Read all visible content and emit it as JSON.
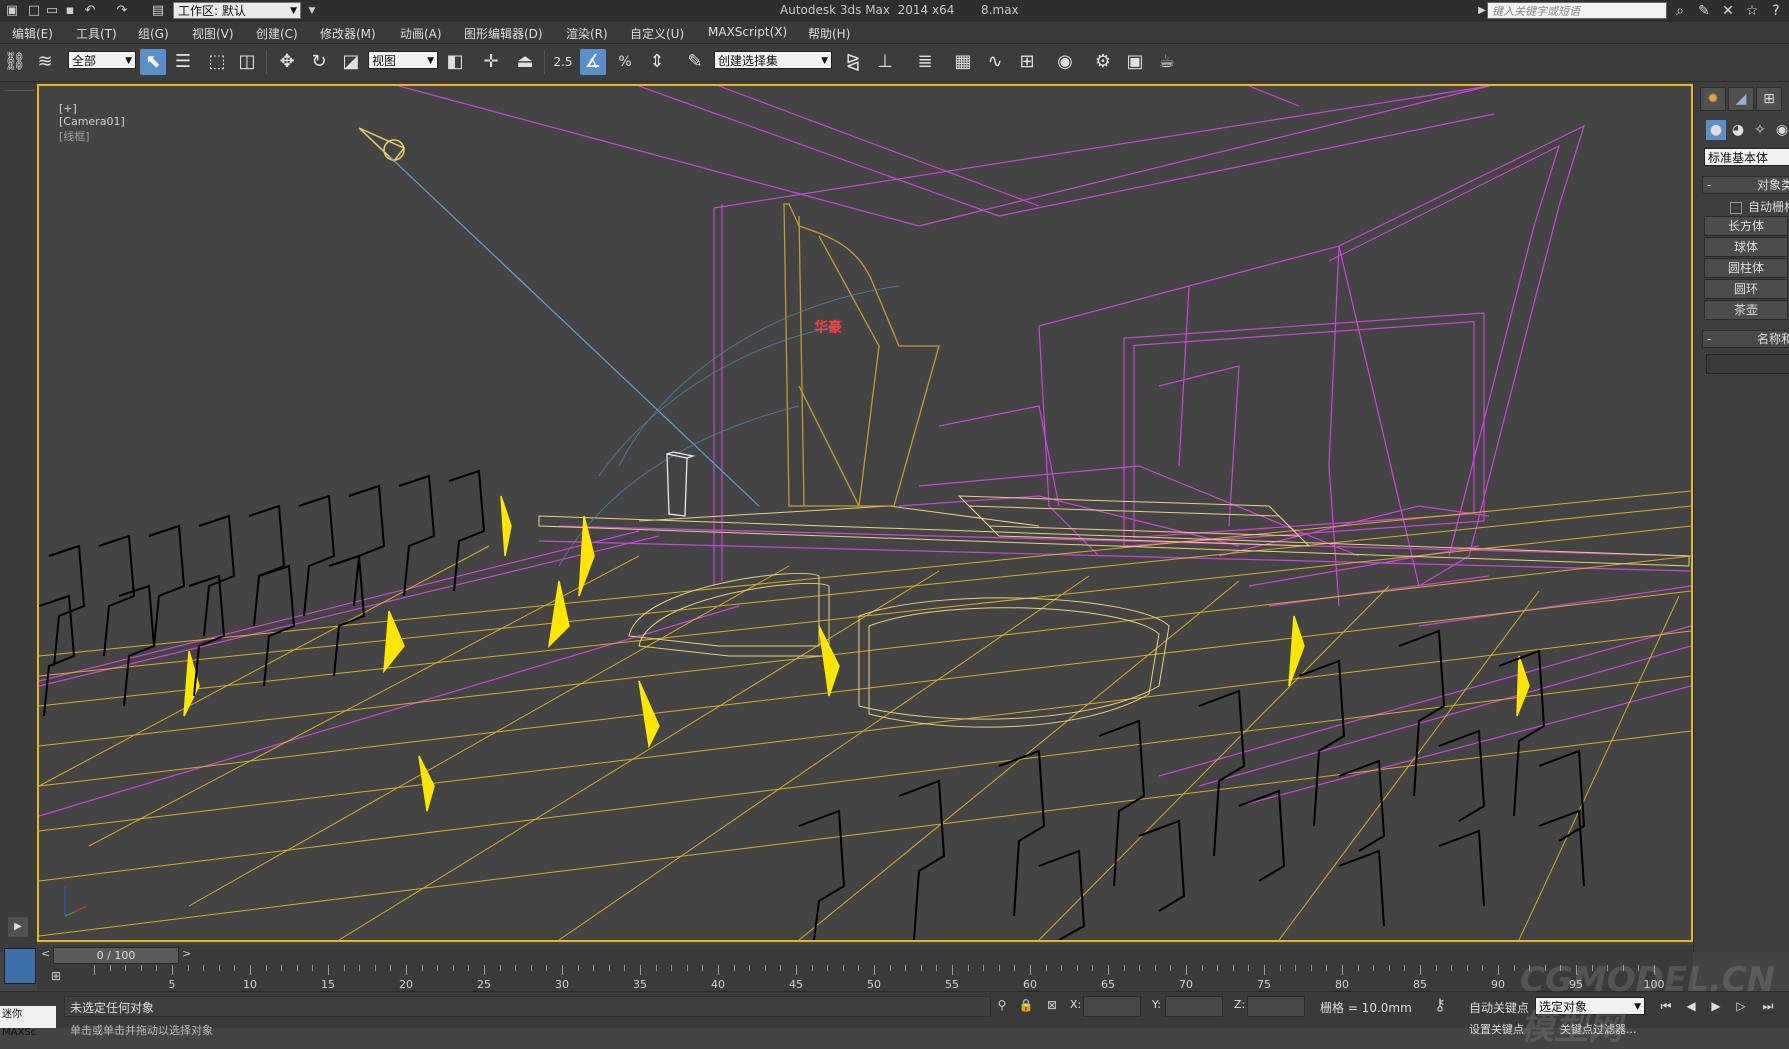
{
  "titlebar": {
    "workspace_label": "工作区: 默认",
    "title": "Autodesk 3ds Max  2014 x64       8.max",
    "search_placeholder": "键入关键字或短语"
  },
  "menu": [
    "编辑(E)",
    "工具(T)",
    "组(G)",
    "视图(V)",
    "创建(C)",
    "修改器(M)",
    "动画(A)",
    "图形编辑器(D)",
    "渲染(R)",
    "自定义(U)",
    "MAXScript(X)",
    "帮助(H)"
  ],
  "toolbar": {
    "selection_filter": "全部",
    "ref_coord": "视图",
    "snap_value": "2.5",
    "named_selection": "创建选择集"
  },
  "viewport": {
    "label_plus": "[+]",
    "label_camera": "[Camera01]",
    "label_mode": "[线框]",
    "logo_text": "华豪",
    "colors": {
      "grid": "#e8b81e",
      "stage": "#cc44dd",
      "chairs": "#000000",
      "camera_line": "#5aa7d8",
      "lights": "#ffe600"
    }
  },
  "command_panel": {
    "category": "标准基本体",
    "object_type_title": "对象类型",
    "autogrid": "自动栅格",
    "buttons": [
      "长方体",
      "球体",
      "圆柱体",
      "圆环",
      "茶壶"
    ],
    "name_color_title": "名称和颜色"
  },
  "timeline": {
    "frame_display": "0 / 100",
    "ticks": [
      5,
      10,
      15,
      20,
      25,
      30,
      35,
      40,
      45,
      50,
      55,
      60,
      65,
      70,
      75,
      80,
      85,
      90,
      95,
      100
    ]
  },
  "status": {
    "maxscript_tab": "迷你 MAXSc",
    "selection_status": "未选定任何对象",
    "prompt": "单击或单击并拖动以选择对象",
    "x_label": "X:",
    "y_label": "Y:",
    "z_label": "Z:",
    "grid": "栅格 = 10.0mm",
    "autokey": "自动关键点",
    "selected": "选定对象",
    "set_key": "设置关键点",
    "key_filters": "关键点过滤器..."
  },
  "watermark": "CGMODEL.CN 模型网"
}
